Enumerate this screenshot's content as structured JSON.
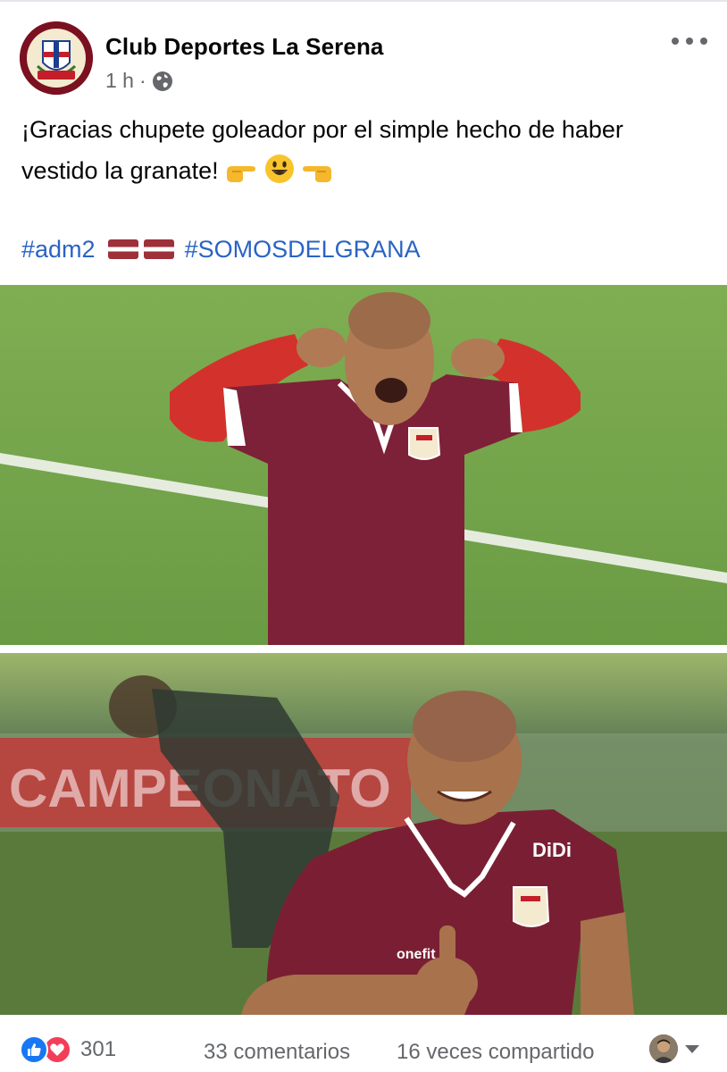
{
  "post": {
    "page_name": "Club Deportes La Serena",
    "time": "1 h",
    "separator": "·",
    "privacy_icon": "globe-icon",
    "more_icon": "more-options-icon",
    "text_line1": "¡Gracias chupete goleador por el simple hecho de haber",
    "text_line2": "vestido la granate!",
    "hashtag1": "#adm2",
    "hashtag2": "#SOMOSDELGRANA",
    "emoji": [
      "point-right-emoji",
      "smiley-emoji",
      "point-left-emoji"
    ],
    "flags": [
      "latvia-flag",
      "latvia-flag"
    ]
  },
  "photos": {
    "photo1": {
      "description_icon": "player-celebration-photo"
    },
    "photo2": {
      "banner_text": "CAMPEONATO",
      "sponsor": "DiDi",
      "brand": "onefit"
    }
  },
  "footer": {
    "reaction_icons": [
      "like-icon",
      "love-icon"
    ],
    "reaction_count": "301",
    "comments": "33 comentarios",
    "shares": "16 veces compartido",
    "viewer_icon": "viewer-avatar"
  },
  "colors": {
    "link": "#2a63c4",
    "meta": "#65676b",
    "like": "#1877f2",
    "love": "#f33e58",
    "club_maroon": "#7a1020"
  }
}
